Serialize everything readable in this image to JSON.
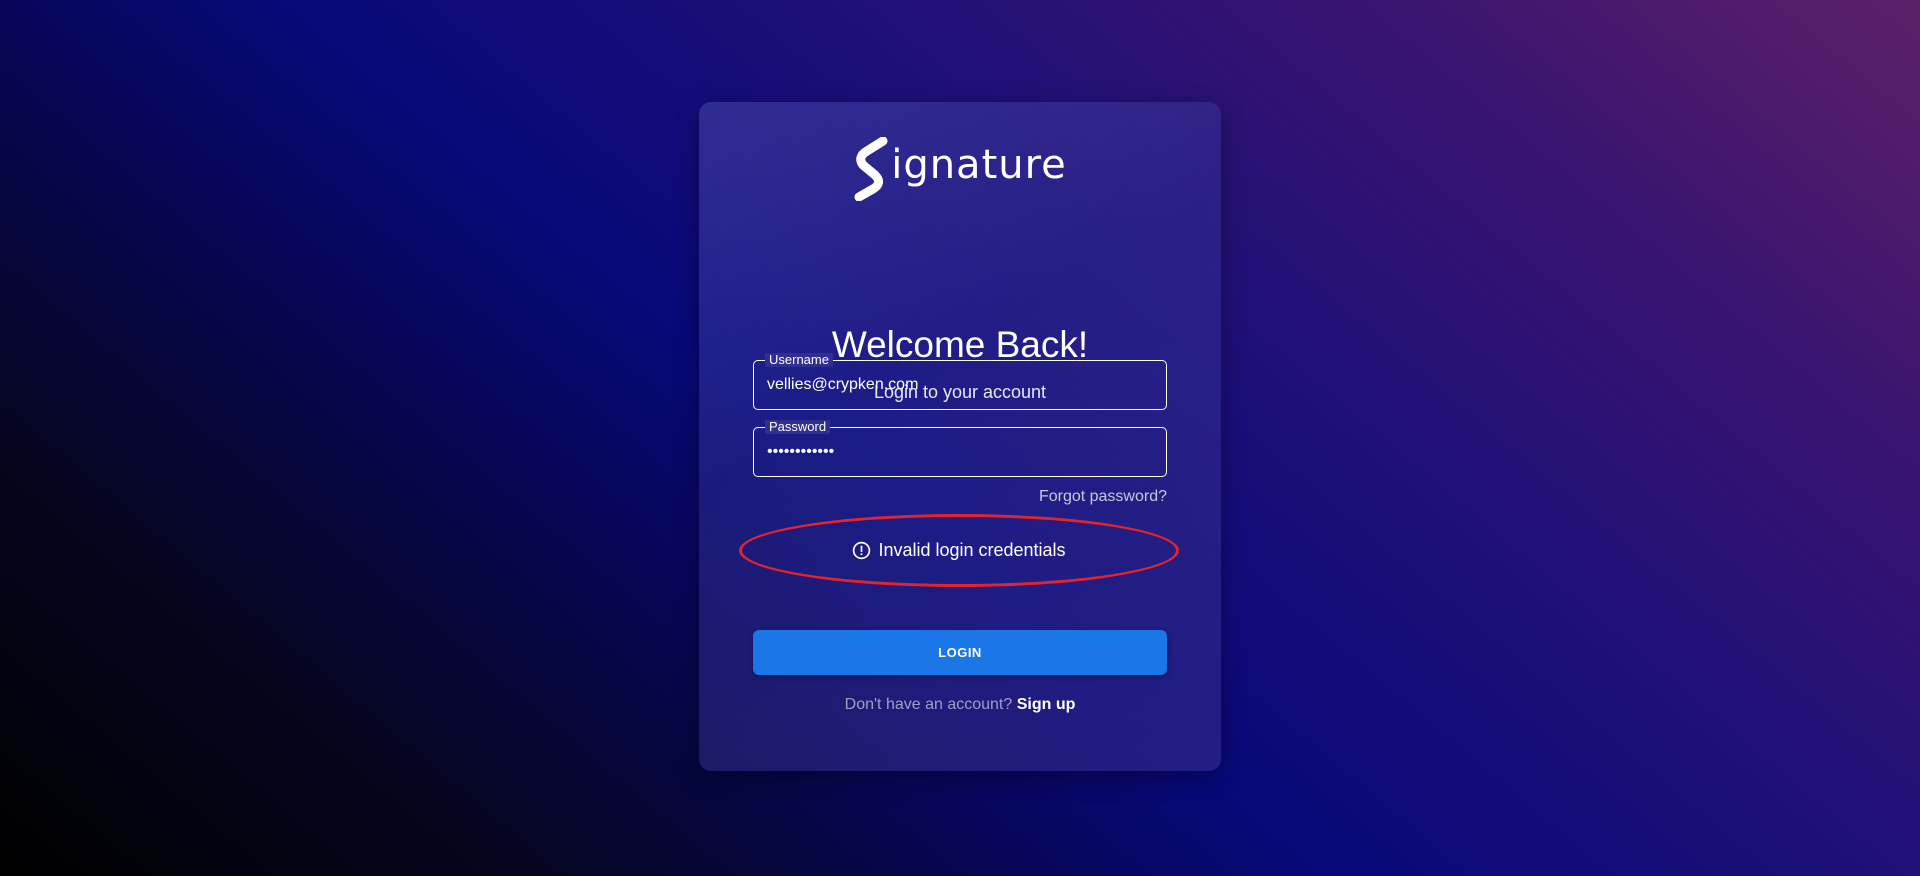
{
  "brand": {
    "logo_text": "ignature",
    "logo_alt": "Signature"
  },
  "header": {
    "title": "Welcome Back!",
    "subtitle": "Login to your account"
  },
  "form": {
    "username": {
      "label": "Username",
      "value": "vellies@crypken.com"
    },
    "password": {
      "label": "Password",
      "value": "••••••••••••"
    },
    "forgot_label": "Forgot password?",
    "error_message": "Invalid login credentials",
    "login_label": "LOGIN",
    "signup_prompt": "Don't have an account? ",
    "signup_label": "Sign up"
  },
  "colors": {
    "button": "#1b76e8",
    "error_outline": "#e3242b"
  },
  "icons": {
    "error": "alert-circle-icon",
    "logo": "signature-s-icon"
  }
}
